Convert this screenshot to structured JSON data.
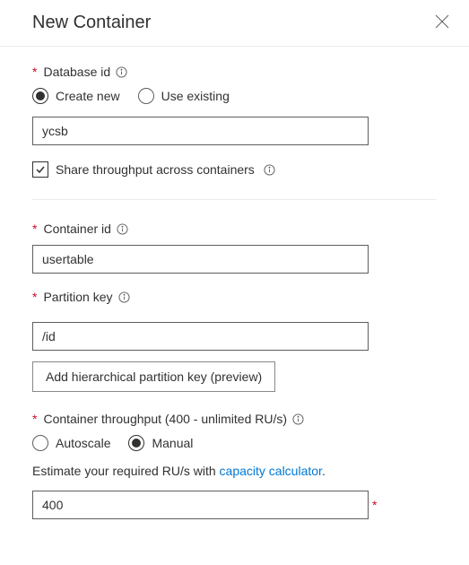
{
  "header": {
    "title": "New Container"
  },
  "database": {
    "label": "Database id",
    "radio_create": "Create new",
    "radio_existing": "Use existing",
    "value": "ycsb",
    "share_label": "Share throughput across containers"
  },
  "container": {
    "label": "Container id",
    "value": "usertable"
  },
  "partition": {
    "label": "Partition key",
    "value": "/id",
    "hier_button": "Add hierarchical partition key (preview)"
  },
  "throughput": {
    "label": "Container throughput (400 - unlimited RU/s)",
    "radio_autoscale": "Autoscale",
    "radio_manual": "Manual",
    "estimate_prefix": "Estimate your required RU/s with ",
    "estimate_link": "capacity calculator",
    "estimate_suffix": ".",
    "value": "400"
  }
}
